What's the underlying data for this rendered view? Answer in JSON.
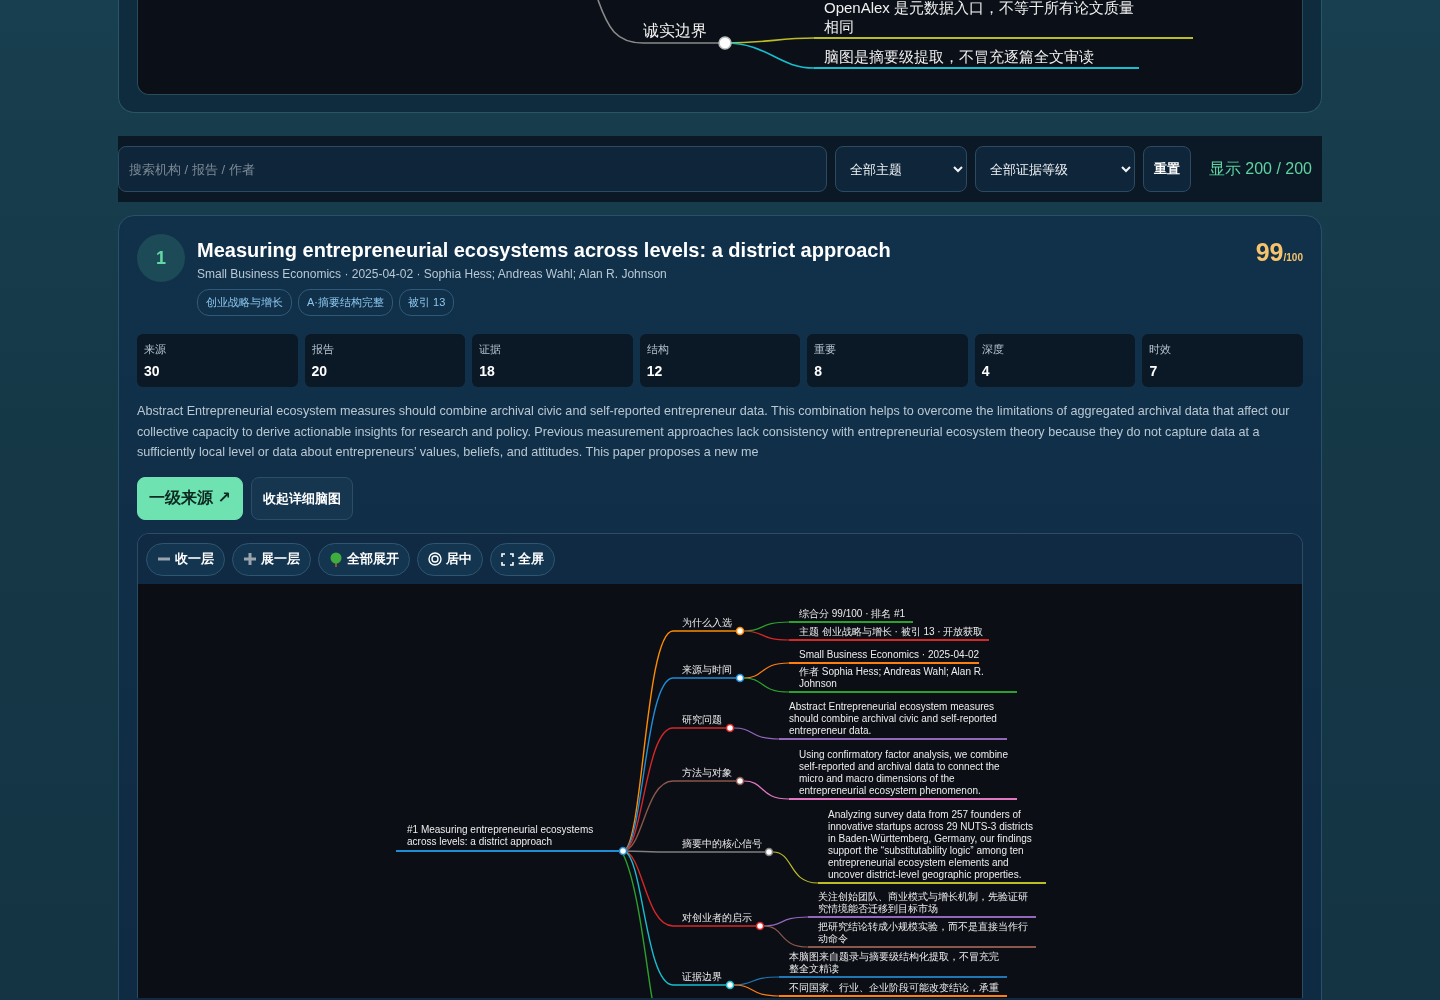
{
  "top_mindmap": {
    "branch": {
      "label": "诚实边界",
      "color": "#8a8a8a",
      "children": [
        {
          "text": "OpenAlex 是元数据入口，不等于所有论文质量相同",
          "color": "#bcbd22"
        },
        {
          "text": "脑图是摘要级提取，不冒充逐篇全文审读",
          "color": "#17becf"
        }
      ]
    }
  },
  "filters": {
    "search": {
      "placeholder": "搜索机构 / 报告 / 作者"
    },
    "topic_select": "全部主题",
    "evidence_select": "全部证据等级",
    "reset_button": "重置",
    "count": "显示 200 / 200"
  },
  "paper": {
    "rank": "1",
    "title": "Measuring entrepreneurial ecosystems across levels: a district approach",
    "meta": "Small Business Economics · 2025-04-02 · Sophia Hess; Andreas Wahl; Alan R. Johnson",
    "tags": [
      "创业战略与增长",
      "A·摘要结构完整",
      "被引 13"
    ],
    "score": "99",
    "score_max": "/100",
    "metrics": [
      {
        "label": "来源",
        "value": "30"
      },
      {
        "label": "报告",
        "value": "20"
      },
      {
        "label": "证据",
        "value": "18"
      },
      {
        "label": "结构",
        "value": "12"
      },
      {
        "label": "重要",
        "value": "8"
      },
      {
        "label": "深度",
        "value": "4"
      },
      {
        "label": "时效",
        "value": "7"
      }
    ],
    "abstract": "Abstract Entrepreneurial ecosystem measures should combine archival civic and self-reported entrepreneur data. This combination helps to overcome the limitations of aggregated archival data that affect our collective capacity to derive actionable insights for research and policy. Previous measurement approaches lack consistency with entrepreneurial ecosystem theory because they do not capture data at a sufficiently local level or data about entrepreneurs’ values, beliefs, and attitudes. This paper proposes a new me",
    "buttons": [
      {
        "kind": "primary",
        "label": "一级来源 ↗"
      },
      {
        "kind": "secondary",
        "label": "收起详细脑图"
      }
    ],
    "mindmap": {
      "toolbar": [
        {
          "kind": "collapse",
          "label": "收一层"
        },
        {
          "kind": "expand",
          "label": "展一层"
        },
        {
          "kind": "expand_all",
          "label": "全部展开"
        },
        {
          "kind": "center",
          "label": "居中"
        },
        {
          "kind": "fullscreen",
          "label": "全屏"
        }
      ],
      "root": {
        "text": "#1 Measuring entrepreneurial ecosystems across levels: a district approach",
        "color": "#1f8dd6",
        "children": [
          {
            "label": "为什么入选",
            "color": "#ff8c00",
            "children": [
              {
                "text": "综合分 99/100 · 排名 #1",
                "color": "#2ca02c"
              },
              {
                "text": "主题 创业战略与增长 · 被引 13 · 开放获取",
                "color": "#d62728"
              }
            ]
          },
          {
            "label": "来源与时间",
            "color": "#1f8dd6",
            "children": [
              {
                "text": "Small Business Economics · 2025-04-02",
                "color": "#ff7f0e"
              },
              {
                "text": "作者 Sophia Hess; Andreas Wahl; Alan R. Johnson",
                "color": "#2ca02c"
              }
            ]
          },
          {
            "label": "研究问题",
            "color": "#d62728",
            "children": [
              {
                "text": "Abstract Entrepreneurial ecosystem measures should combine archival civic and self-reported entrepreneur data.",
                "color": "#9467bd"
              }
            ]
          },
          {
            "label": "方法与对象",
            "color": "#8c564b",
            "children": [
              {
                "text": "Using confirmatory factor analysis, we combine self-reported and archival data to connect the micro and macro dimensions of the entrepreneurial ecosystem phenomenon.",
                "color": "#e377c2"
              }
            ]
          },
          {
            "label": "摘要中的核心信号",
            "color": "#7f7f7f",
            "children": [
              {
                "text": "Analyzing survey data from 257 founders of innovative startups across 29 NUTS-3 districts in Baden-Württemberg, Germany, our findings support the “substitutability logic” among ten entrepreneurial ecosystem elements and uncover district-level geographic properties.",
                "color": "#bcbd22"
              }
            ]
          },
          {
            "label": "对创业者的启示",
            "color": "#d62728",
            "children": [
              {
                "text": "关注创始团队、商业模式与增长机制，先验证研究情境能否迁移到目标市场",
                "color": "#9467bd"
              },
              {
                "text": "把研究结论转成小规模实验，而不是直接当作行动命令",
                "color": "#8c564b"
              }
            ]
          },
          {
            "label": "证据边界",
            "color": "#17becf",
            "children": [
              {
                "text": "本脑图来自题录与摘要级结构化提取，不冒充完整全文精读",
                "color": "#1f77b4"
              },
              {
                "text": "不同国家、行业、企业阶段可能改变结论，承重",
                "color": "#ff7f0e"
              }
            ]
          }
        ]
      }
    }
  }
}
